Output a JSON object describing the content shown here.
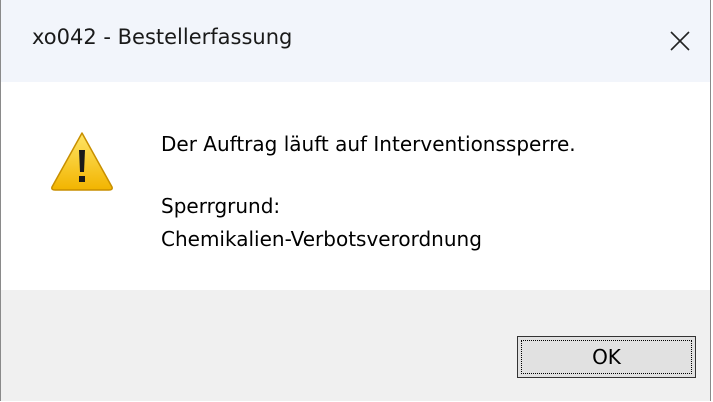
{
  "window": {
    "title": "xo042 - Bestellerfassung",
    "close_icon": "close-icon"
  },
  "message": {
    "icon": "warning-icon",
    "line1": "Der Auftrag läuft auf Interventionssperre.",
    "line2": "Sperrgrund:",
    "line3": "Chemikalien-Verbotsverordnung"
  },
  "buttons": {
    "ok_label": "OK"
  },
  "colors": {
    "titlebar_bg": "#f2f5fb",
    "footer_bg": "#f0f0f0",
    "warning_yellow": "#f7c200"
  }
}
